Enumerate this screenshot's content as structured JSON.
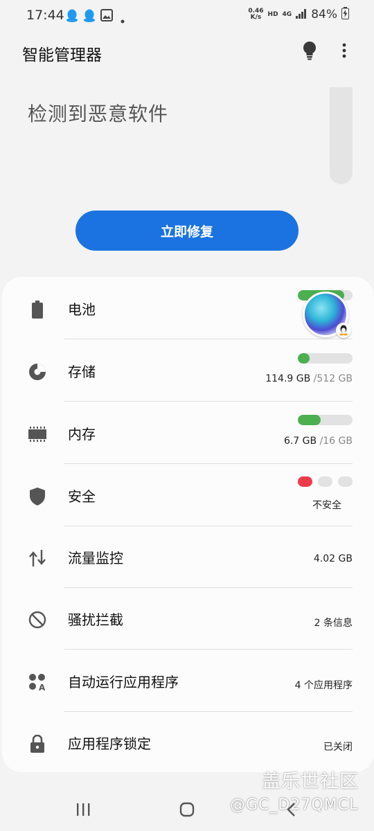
{
  "status_bar": {
    "time": "17:44",
    "speed_value": "0.46",
    "speed_unit": "K/s",
    "hd": "HD",
    "network": "4G",
    "battery": "84%"
  },
  "header": {
    "title": "智能管理器"
  },
  "alert": {
    "message": "检测到恶意软件",
    "fix_button": "立即修复"
  },
  "items": {
    "battery": {
      "label": "电池",
      "progress": 0.85
    },
    "storage": {
      "label": "存储",
      "used": "114.9 GB",
      "total": "/512 GB",
      "progress": 0.22
    },
    "memory": {
      "label": "内存",
      "used": "6.7 GB",
      "total": "/16 GB",
      "progress": 0.42
    },
    "security": {
      "label": "安全",
      "status": "不安全",
      "level": 1,
      "level_max": 3
    },
    "data_usage": {
      "label": "流量监控",
      "value": "4.02 GB"
    },
    "block": {
      "label": "骚扰拦截",
      "value": "2 条信息"
    },
    "auto_run": {
      "label": "自动运行应用程序",
      "value": "4 个应用程序"
    },
    "app_lock": {
      "label": "应用程序锁定",
      "value": "已关闭"
    }
  },
  "colors": {
    "accent": "#1a73e0",
    "progress_green": "#4caf50",
    "danger_red": "#ee3b4a"
  },
  "watermark": {
    "title": "盖乐世社区",
    "handle": "@GC_D27QMCL"
  }
}
